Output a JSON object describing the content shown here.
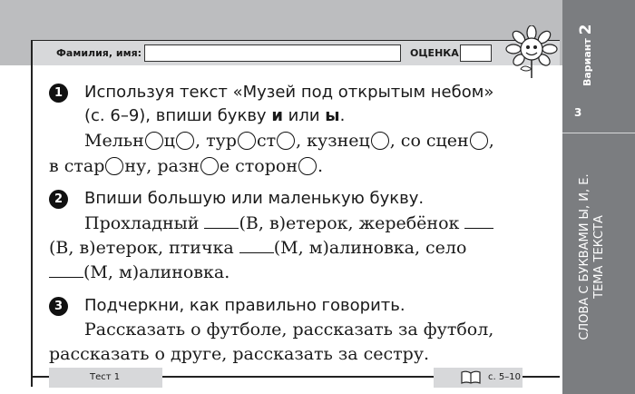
{
  "header": {
    "name_label": "Фамилия, имя:",
    "grade_label": "ОЦЕНКА:"
  },
  "sidebar": {
    "variant_label": "Вариант",
    "variant_number": "2",
    "page_number": "3",
    "topic_line1": "СЛОВА С БУКВАМИ Ы, И, Е.",
    "topic_line2": "ТЕМА ТЕКСТА"
  },
  "task1": {
    "number": "1",
    "instruction_line1": "Используя текст «Музей под открытым небом»",
    "instruction_line2_pre": "(с. 6–9), впиши букву ",
    "letter1": "и",
    "instruction_or": " или ",
    "letter2": "ы",
    "period": ".",
    "l1_a": "Мельн",
    "l1_b": "ц",
    "l1_c": ", тур",
    "l1_d": "ст",
    "l1_e": ", кузнец",
    "l1_f": ", со сцен",
    "l1_g": ",",
    "l2_a": "в стар",
    "l2_b": "ну, разн",
    "l2_c": "е сторон",
    "l2_d": "."
  },
  "task2": {
    "number": "2",
    "instruction": "Впиши большую или маленькую букву.",
    "l1_a": "Прохладный ",
    "l1_b": "(В, в)етерок, жеребёнок ",
    "l2_a": "(В, в)етерок, птичка ",
    "l2_b": "(М, м)алиновка, село",
    "l3_a": "(М, м)алиновка."
  },
  "task3": {
    "number": "3",
    "instruction": "Подчеркни, как правильно говорить.",
    "line1": "Рассказать о футболе, рассказать за футбол,",
    "line2": "рассказать о друге, рассказать за сестру."
  },
  "footer": {
    "test_label": "Тест 1",
    "pages_label": "с. 5–10"
  }
}
